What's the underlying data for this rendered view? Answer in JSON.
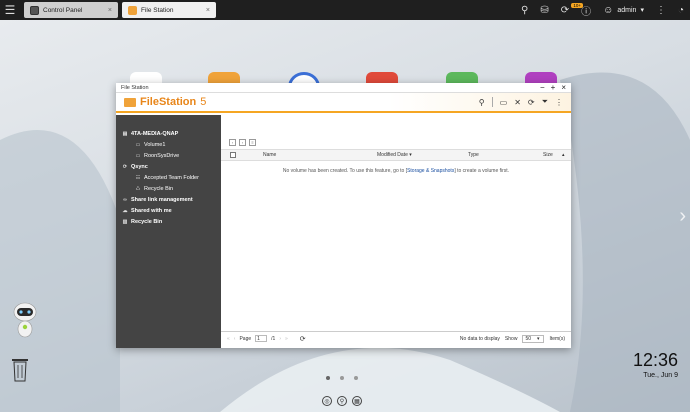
{
  "taskbar": {
    "tabs": [
      {
        "label": "Control Panel",
        "close": "×"
      },
      {
        "label": "File Station",
        "close": "×"
      }
    ],
    "user": "admin",
    "badge": "10+"
  },
  "window": {
    "title": "File Station",
    "app_name_bold": "FileStation",
    "app_version": " 5"
  },
  "sidebar": {
    "items": [
      {
        "label": "4TA-MEDIA-QNAP"
      },
      {
        "label": "Volume1"
      },
      {
        "label": "RoonSysDrive"
      },
      {
        "label": "Qsync"
      },
      {
        "label": "Accepted Team Folder"
      },
      {
        "label": "Recycle Bin"
      },
      {
        "label": "Share link management"
      },
      {
        "label": "Shared with me"
      },
      {
        "label": "Recycle Bin"
      }
    ]
  },
  "table": {
    "columns": [
      "Name",
      "Modified Date",
      "Type",
      "Size"
    ],
    "empty_before": "No volume has been created. To use this feature, go to [",
    "empty_link": "Storage & Snapshots",
    "empty_after": "] to create a volume first."
  },
  "pager": {
    "page_label": "Page",
    "page_value": "1",
    "page_total": "/1",
    "status": "No data to display",
    "show_label": "Show",
    "show_value": "50",
    "items_label": "Item(s)"
  },
  "clock": {
    "time": "12:36",
    "date": "Tue., Jun 9"
  },
  "colors": {
    "accent": "#f5a623",
    "sidebar_bg": "#444444",
    "taskbar_bg": "#1f1f1f"
  }
}
